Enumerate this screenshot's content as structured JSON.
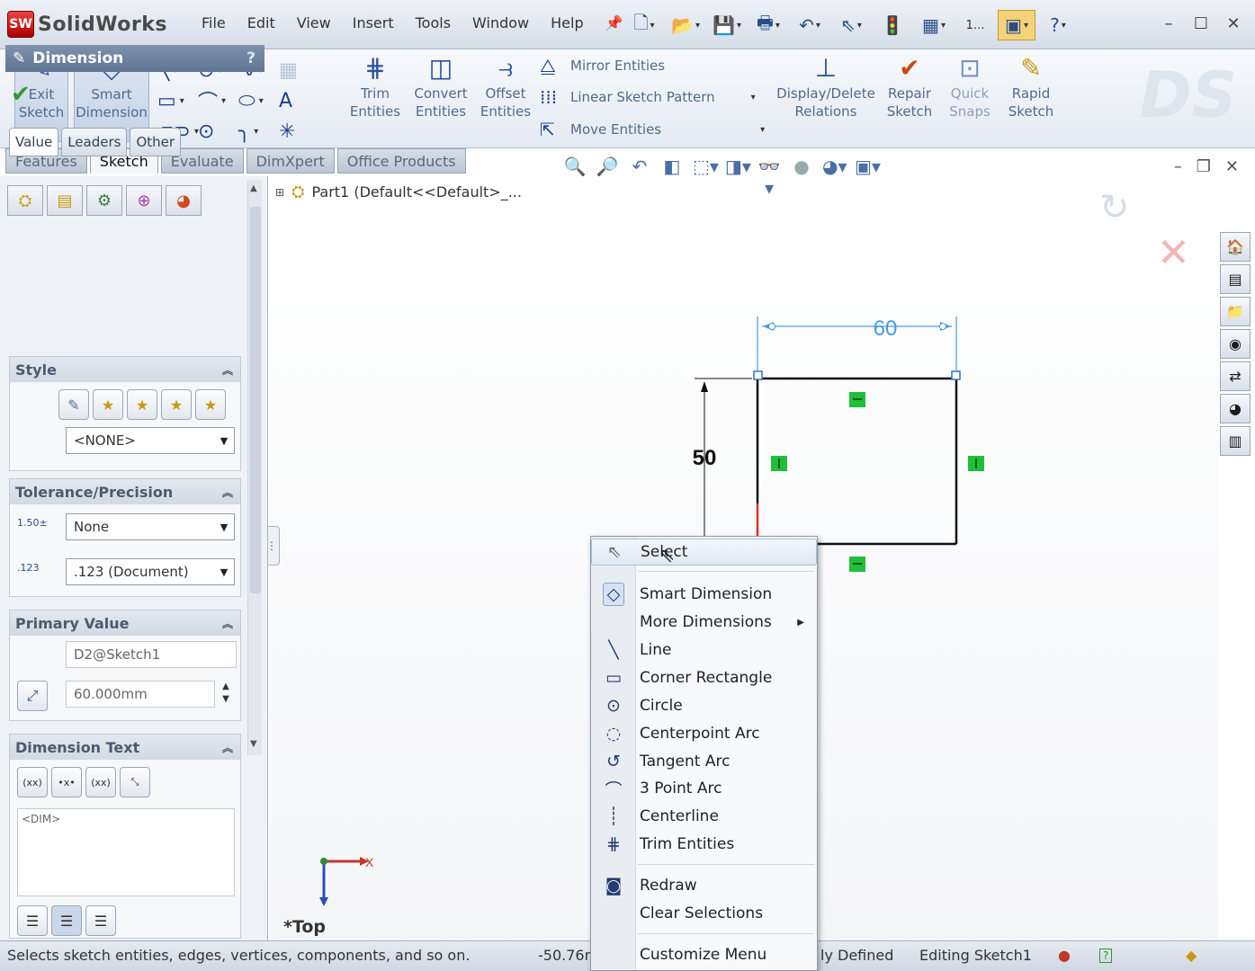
{
  "app": {
    "logo_text": "SolidWorks",
    "logo_mark": "SW"
  },
  "menubar": [
    "File",
    "Edit",
    "View",
    "Insert",
    "Tools",
    "Window",
    "Help"
  ],
  "quick_tools": [
    "new-document-icon",
    "open-folder-icon",
    "save-icon",
    "print-icon",
    "undo-icon",
    "select-arrow-icon",
    "rebuild-traffic-light-icon",
    "file-properties-icon",
    "options-icon",
    "help-icon"
  ],
  "quick_tools_more": "1...",
  "command_manager": {
    "exit_sketch": "Exit Sketch",
    "smart_dimension": "Smart Dimension",
    "trim_entities": "Trim Entities",
    "convert_entities": "Convert Entities",
    "offset_entities": "Offset Entities",
    "mirror_entities": "Mirror Entities",
    "linear_sketch_pattern": "Linear Sketch Pattern",
    "move_entities": "Move Entities",
    "display_delete_relations": "Display/Delete Relations",
    "repair_sketch": "Repair Sketch",
    "quick_snaps": "Quick Snaps",
    "rapid_sketch": "Rapid Sketch"
  },
  "tabs": [
    "Features",
    "Sketch",
    "Evaluate",
    "DimXpert",
    "Office Products"
  ],
  "active_tab": "Sketch",
  "feature_tree": {
    "part_label": "Part1  (Default<<Default>_..."
  },
  "property_manager": {
    "title": "Dimension",
    "help": "?",
    "subtabs": [
      "Value",
      "Leaders",
      "Other"
    ],
    "style": {
      "title": "Style",
      "dropdown": "<NONE>"
    },
    "tolerance": {
      "title": "Tolerance/Precision",
      "tolerance_type": "None",
      "precision": ".123 (Document)"
    },
    "primary_value": {
      "title": "Primary Value",
      "name": "D2@Sketch1",
      "value": "60.000mm"
    },
    "dimension_text": {
      "title": "Dimension Text",
      "text": "<DIM>"
    }
  },
  "sketch": {
    "horizontal_dim": "60",
    "vertical_dim": "50",
    "view_label": "*Top",
    "axis_x": "X"
  },
  "context_menu": {
    "items": [
      {
        "label": "Select",
        "icon": "select-arrow-icon"
      },
      {
        "label": "Smart Dimension",
        "icon": "smart-dimension-icon"
      },
      {
        "label": "More Dimensions",
        "icon": ""
      },
      {
        "label": "Line",
        "icon": "line-icon"
      },
      {
        "label": "Corner Rectangle",
        "icon": "rectangle-icon"
      },
      {
        "label": "Circle",
        "icon": "circle-icon"
      },
      {
        "label": "Centerpoint Arc",
        "icon": "centerpoint-arc-icon"
      },
      {
        "label": "Tangent Arc",
        "icon": "tangent-arc-icon"
      },
      {
        "label": "3 Point Arc",
        "icon": "three-point-arc-icon"
      },
      {
        "label": "Centerline",
        "icon": "centerline-icon"
      },
      {
        "label": "Trim Entities",
        "icon": "trim-icon"
      },
      {
        "label": "Redraw",
        "icon": "redraw-icon"
      },
      {
        "label": "Clear Selections",
        "icon": ""
      },
      {
        "label": "Customize Menu",
        "icon": ""
      }
    ]
  },
  "statusbar": {
    "message": "Selects sketch entities, edges, vertices, components, and so on.",
    "coordinate": "-50.76n",
    "definition": "ly Defined",
    "editing": "Editing Sketch1"
  },
  "colors": {
    "accent_blue": "#1d3f8f",
    "relation_green": "#1fbf3a",
    "dimension_blue": "#4a9ae0"
  }
}
